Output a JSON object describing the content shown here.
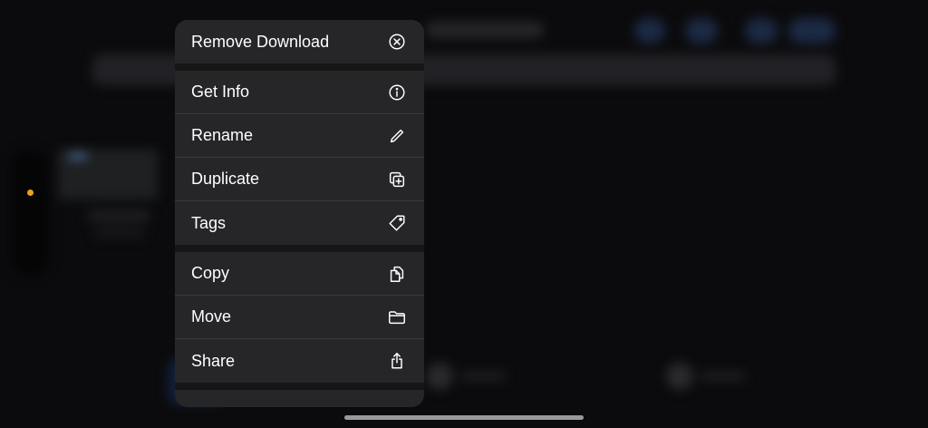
{
  "context_menu": {
    "items": [
      {
        "label": "Remove Download",
        "icon": "remove-download-icon"
      },
      {
        "label": "Get Info",
        "icon": "info-icon"
      },
      {
        "label": "Rename",
        "icon": "pencil-icon"
      },
      {
        "label": "Duplicate",
        "icon": "duplicate-icon"
      },
      {
        "label": "Tags",
        "icon": "tag-icon"
      },
      {
        "label": "Copy",
        "icon": "copy-icon"
      },
      {
        "label": "Move",
        "icon": "folder-icon"
      },
      {
        "label": "Share",
        "icon": "share-icon"
      }
    ]
  },
  "colors": {
    "background": "#0b0b0d",
    "menu_background": "#262628",
    "separator": "#3a3a3c",
    "sidebar_dot": "#f0a020"
  }
}
